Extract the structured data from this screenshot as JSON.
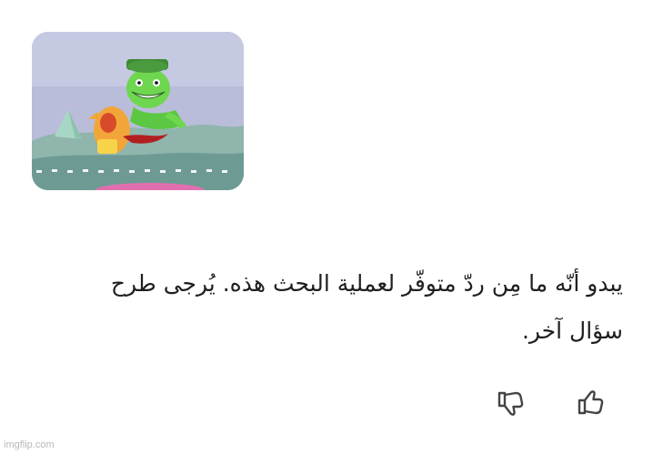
{
  "image_card": {
    "icon": "cartoon-image-thumbnail",
    "colors": {
      "sky": "#b9bdd9",
      "ground": "#78a49a",
      "character_green": "#6fd64f",
      "character_orange": "#f2a63a"
    }
  },
  "response": {
    "text": "يبدو أنّه ما مِن ردّ متوفّر لعملية البحث هذه. يُرجى طرح سؤال آخر."
  },
  "feedback": {
    "dislike_icon": "thumbs-down-icon",
    "like_icon": "thumbs-up-icon",
    "icon_color": "#444444"
  },
  "watermark": {
    "text": "imgflip.com"
  }
}
